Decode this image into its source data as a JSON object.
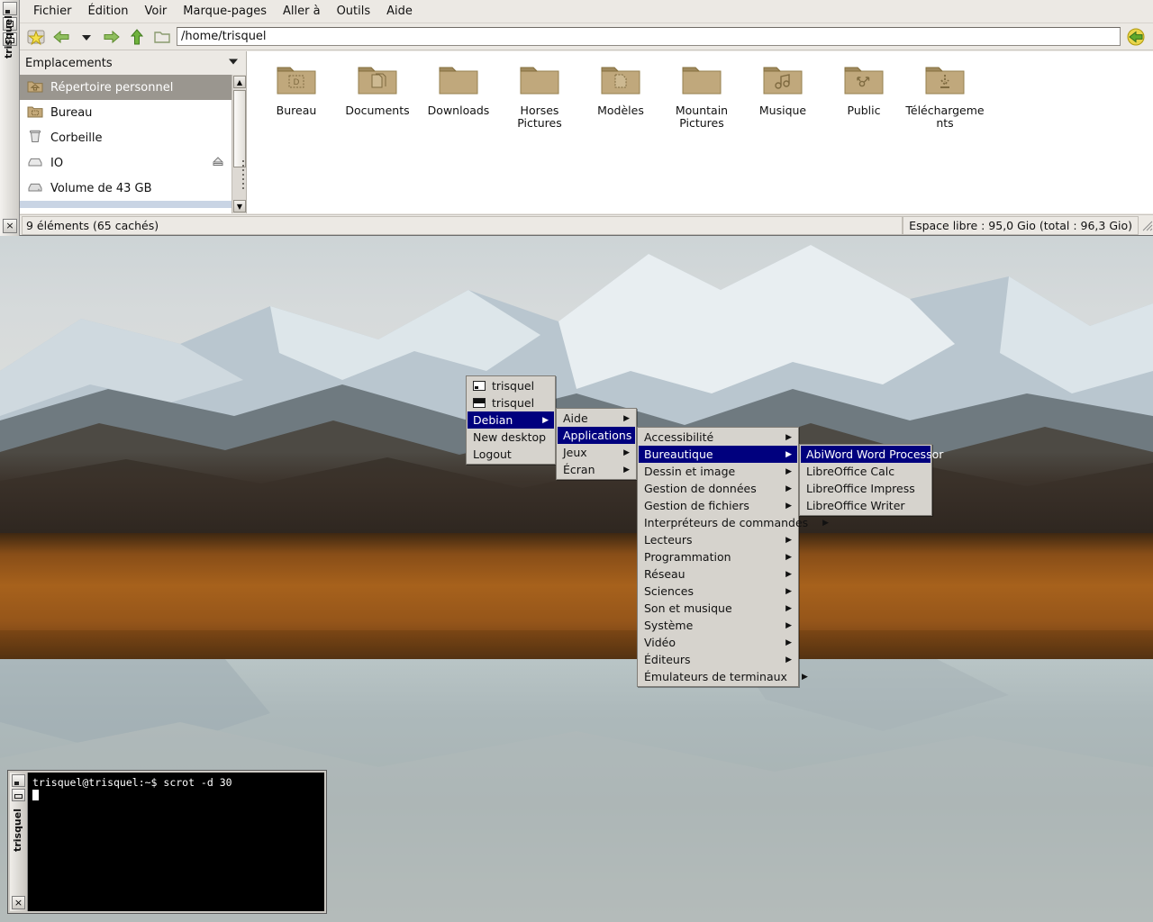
{
  "filemanager": {
    "window_title": "trisquel",
    "close_label": "×",
    "menubar": [
      {
        "label": "Fichier",
        "mnemonic": "F"
      },
      {
        "label": "Édition",
        "mnemonic": "t"
      },
      {
        "label": "Voir",
        "mnemonic": "V"
      },
      {
        "label": "Marque-pages",
        "mnemonic": "M"
      },
      {
        "label": "Aller à",
        "mnemonic": "ll"
      },
      {
        "label": "Outils",
        "mnemonic": "l"
      },
      {
        "label": "Aide",
        "mnemonic": "A"
      }
    ],
    "toolbar": {
      "bookmark_icon": "star-icon",
      "back_icon": "back-arrow-icon",
      "history_icon": "chevron-down-icon",
      "forward_icon": "forward-arrow-icon",
      "up_icon": "up-arrow-icon",
      "folder_icon": "open-folder-icon",
      "go_icon": "go-arrow-icon"
    },
    "path_value": "/home/trisquel",
    "sidebar": {
      "header": "Emplacements",
      "header_icon": "chevron-down-icon",
      "items": [
        {
          "label": "Répertoire personnel",
          "icon": "home-folder-icon",
          "selected": true,
          "eject": false
        },
        {
          "label": "Bureau",
          "icon": "desktop-folder-icon",
          "selected": false,
          "eject": false
        },
        {
          "label": "Corbeille",
          "icon": "trash-icon",
          "selected": false,
          "eject": false
        },
        {
          "label": "IO",
          "icon": "drive-icon",
          "selected": false,
          "eject": true
        },
        {
          "label": "Volume de 43 GB",
          "icon": "harddisk-icon",
          "selected": false,
          "eject": false
        }
      ]
    },
    "files": [
      {
        "name": "Bureau",
        "icon": "desktop-folder-icon"
      },
      {
        "name": "Documents",
        "icon": "documents-folder-icon"
      },
      {
        "name": "Downloads",
        "icon": "plain-folder-icon"
      },
      {
        "name": "Horses Pictures",
        "icon": "plain-folder-icon"
      },
      {
        "name": "Modèles",
        "icon": "templates-folder-icon"
      },
      {
        "name": "Mountain Pictures",
        "icon": "plain-folder-icon"
      },
      {
        "name": "Musique",
        "icon": "music-folder-icon"
      },
      {
        "name": "Public",
        "icon": "public-folder-icon"
      },
      {
        "name": "Téléchargements",
        "icon": "downloads-folder-icon"
      }
    ],
    "status": {
      "left": "9 éléments (65 cachés)",
      "right": "Espace libre : 95,0 Gio (total : 96,3 Gio)"
    }
  },
  "menus": {
    "root": {
      "items": [
        {
          "label": "trisquel",
          "icon": "window-icon-1",
          "submenu": false,
          "highlighted": false
        },
        {
          "label": "trisquel",
          "icon": "window-icon-2",
          "submenu": false,
          "highlighted": false
        },
        {
          "label": "Debian",
          "icon": "",
          "submenu": true,
          "highlighted": true
        },
        {
          "label": "New desktop",
          "icon": "",
          "submenu": false,
          "highlighted": false
        },
        {
          "label": "Logout",
          "icon": "",
          "submenu": false,
          "highlighted": false
        }
      ]
    },
    "debian": {
      "items": [
        {
          "label": "Aide",
          "submenu": true,
          "highlighted": false
        },
        {
          "label": "Applications",
          "submenu": true,
          "highlighted": true
        },
        {
          "label": "Jeux",
          "submenu": true,
          "highlighted": false
        },
        {
          "label": "Écran",
          "submenu": true,
          "highlighted": false
        }
      ]
    },
    "applications": {
      "items": [
        {
          "label": "Accessibilité",
          "submenu": true,
          "highlighted": false
        },
        {
          "label": "Bureautique",
          "submenu": true,
          "highlighted": true
        },
        {
          "label": "Dessin et image",
          "submenu": true,
          "highlighted": false
        },
        {
          "label": "Gestion de données",
          "submenu": true,
          "highlighted": false
        },
        {
          "label": "Gestion de fichiers",
          "submenu": true,
          "highlighted": false
        },
        {
          "label": "Interpréteurs de commandes",
          "submenu": true,
          "highlighted": false
        },
        {
          "label": "Lecteurs",
          "submenu": true,
          "highlighted": false
        },
        {
          "label": "Programmation",
          "submenu": true,
          "highlighted": false
        },
        {
          "label": "Réseau",
          "submenu": true,
          "highlighted": false
        },
        {
          "label": "Sciences",
          "submenu": true,
          "highlighted": false
        },
        {
          "label": "Son et musique",
          "submenu": true,
          "highlighted": false
        },
        {
          "label": "Système",
          "submenu": true,
          "highlighted": false
        },
        {
          "label": "Vidéo",
          "submenu": true,
          "highlighted": false
        },
        {
          "label": "Éditeurs",
          "submenu": true,
          "highlighted": false
        },
        {
          "label": "Émulateurs de terminaux",
          "submenu": true,
          "highlighted": false
        }
      ]
    },
    "bureautique": {
      "items": [
        {
          "label": "AbiWord Word Processor",
          "submenu": false,
          "highlighted": true
        },
        {
          "label": "LibreOffice Calc",
          "submenu": false,
          "highlighted": false
        },
        {
          "label": "LibreOffice Impress",
          "submenu": false,
          "highlighted": false
        },
        {
          "label": "LibreOffice Writer",
          "submenu": false,
          "highlighted": false
        }
      ]
    }
  },
  "terminal": {
    "window_title": "trisquel",
    "close_label": "×",
    "line": "trisquel@trisquel:~$ scrot -d 30"
  },
  "colors": {
    "menu_highlight": "#00007e",
    "menu_bg": "#d6d3cd",
    "window_bg": "#ece9e4",
    "sidebar_selected": "#9a968f"
  }
}
